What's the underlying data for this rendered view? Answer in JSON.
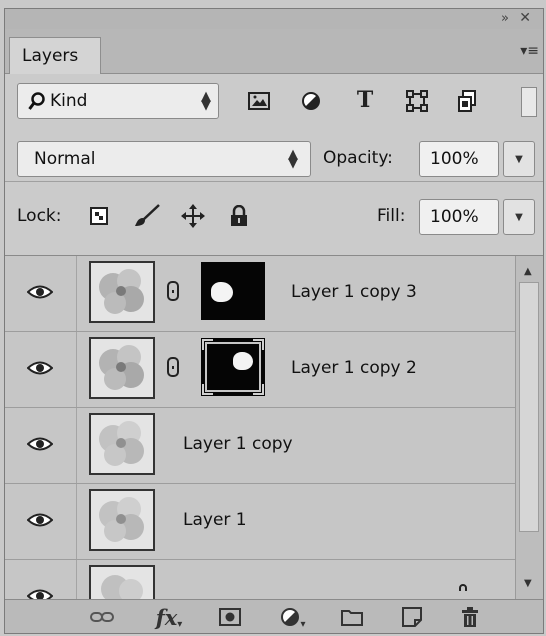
{
  "panel": {
    "title": "Layers",
    "collapse_icon": "double-chevron-icon",
    "collapse_glyph": "»",
    "close_icon": "close-icon",
    "close_glyph": "✕",
    "menu_icon": "panel-menu-icon",
    "menu_glyph": "▾≡"
  },
  "filter": {
    "kind_label": "Kind",
    "search_icon": "search-icon",
    "filter_icons": [
      "pixel-layer-filter-icon",
      "adjustment-layer-filter-icon",
      "type-layer-filter-icon",
      "shape-layer-filter-icon",
      "smart-object-filter-icon"
    ]
  },
  "blend": {
    "mode": "Normal",
    "opacity_label": "Opacity:",
    "opacity_value": "100%"
  },
  "lock": {
    "label": "Lock:",
    "icons": [
      "lock-transparent-pixels-icon",
      "lock-image-pixels-icon",
      "lock-position-icon",
      "lock-all-icon"
    ],
    "fill_label": "Fill:",
    "fill_value": "100%"
  },
  "layers": [
    {
      "name": "Layer 1 copy 3",
      "visible": true,
      "has_mask": true,
      "selected_mask": false
    },
    {
      "name": "Layer 1 copy 2",
      "visible": true,
      "has_mask": true,
      "selected_mask": true
    },
    {
      "name": "Layer 1 copy",
      "visible": true,
      "has_mask": false
    },
    {
      "name": "Layer 1",
      "visible": true,
      "has_mask": false
    }
  ],
  "bottom_toolbar": {
    "fx_label": "fx",
    "icons": [
      "link-layers-icon",
      "layer-style-fx-icon",
      "add-mask-icon",
      "adjustment-layer-icon",
      "new-group-folder-icon",
      "new-layer-icon",
      "delete-trash-icon"
    ]
  }
}
